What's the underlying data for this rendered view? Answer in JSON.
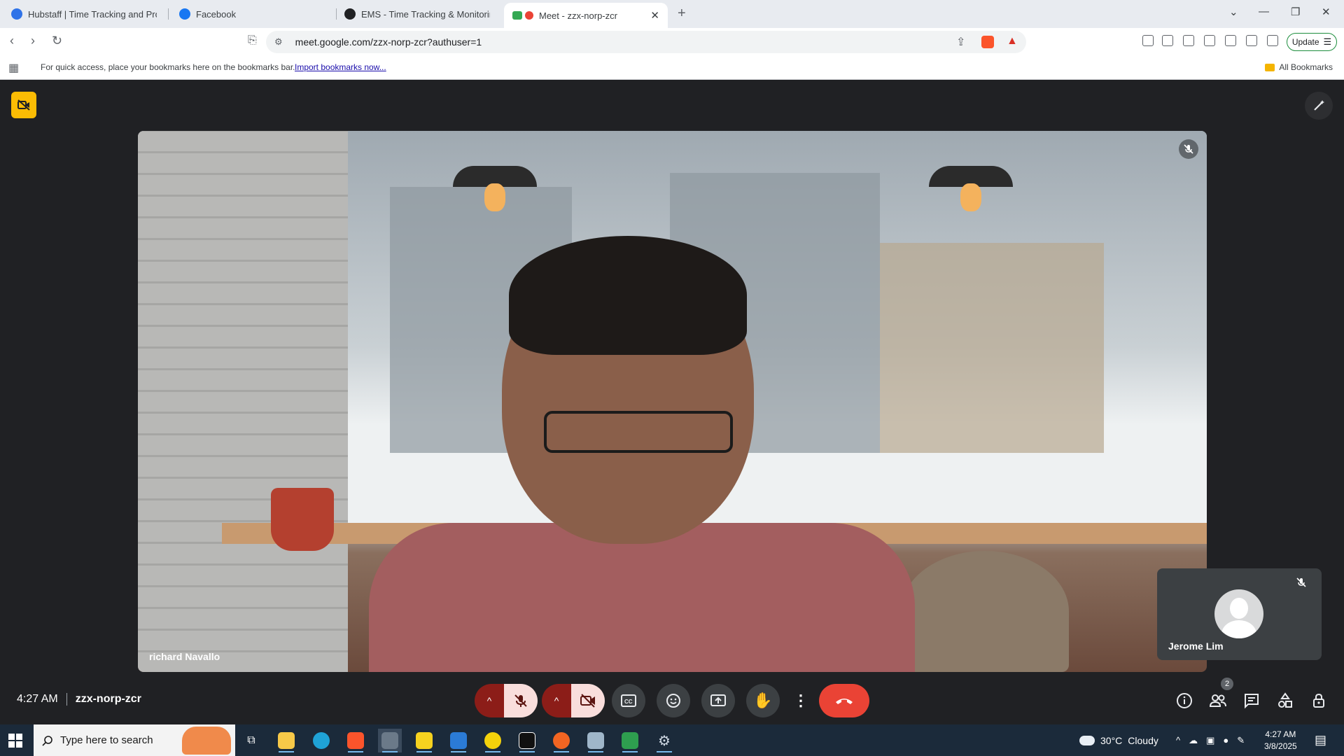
{
  "browser": {
    "tabs": [
      {
        "label": "Hubstaff | Time Tracking and Produ",
        "favicon_color": "#2f73e8"
      },
      {
        "label": "Facebook",
        "favicon_color": "#1877f2"
      },
      {
        "label": "EMS - Time Tracking & Monitoring",
        "favicon_color": "#202124"
      },
      {
        "label": "Meet - zzx-norp-zcr",
        "favicon_color": "#ea4335",
        "active": true
      }
    ],
    "url": "meet.google.com/zzx-norp-zcr?authuser=1",
    "update_label": "Update",
    "bookmarks_bar": {
      "message": "For quick access, place your bookmarks here on the bookmarks bar.",
      "import_link": "Import bookmarks now...",
      "all_bookmarks": "All Bookmarks"
    }
  },
  "meet": {
    "main_participant": "richard Navallo",
    "side_participant": "Jerome Lim",
    "time": "4:27 AM",
    "meeting_code": "zzx-norp-zcr",
    "participant_count": "2",
    "controls": [
      "mic-options",
      "mic-off",
      "camera-options",
      "camera-off",
      "captions",
      "reactions",
      "present",
      "raise-hand",
      "more-options",
      "leave-call"
    ],
    "accent_colors": {
      "leave": "#ea4335",
      "muted_bg": "#f9dedc",
      "muted_caret": "#8c1d18",
      "badge": "#fbbc04"
    }
  },
  "taskbar": {
    "search_placeholder": "Type here to search",
    "weather_temp": "30°C",
    "weather_desc": "Cloudy",
    "clock_time": "4:27 AM",
    "clock_date": "3/8/2025"
  }
}
